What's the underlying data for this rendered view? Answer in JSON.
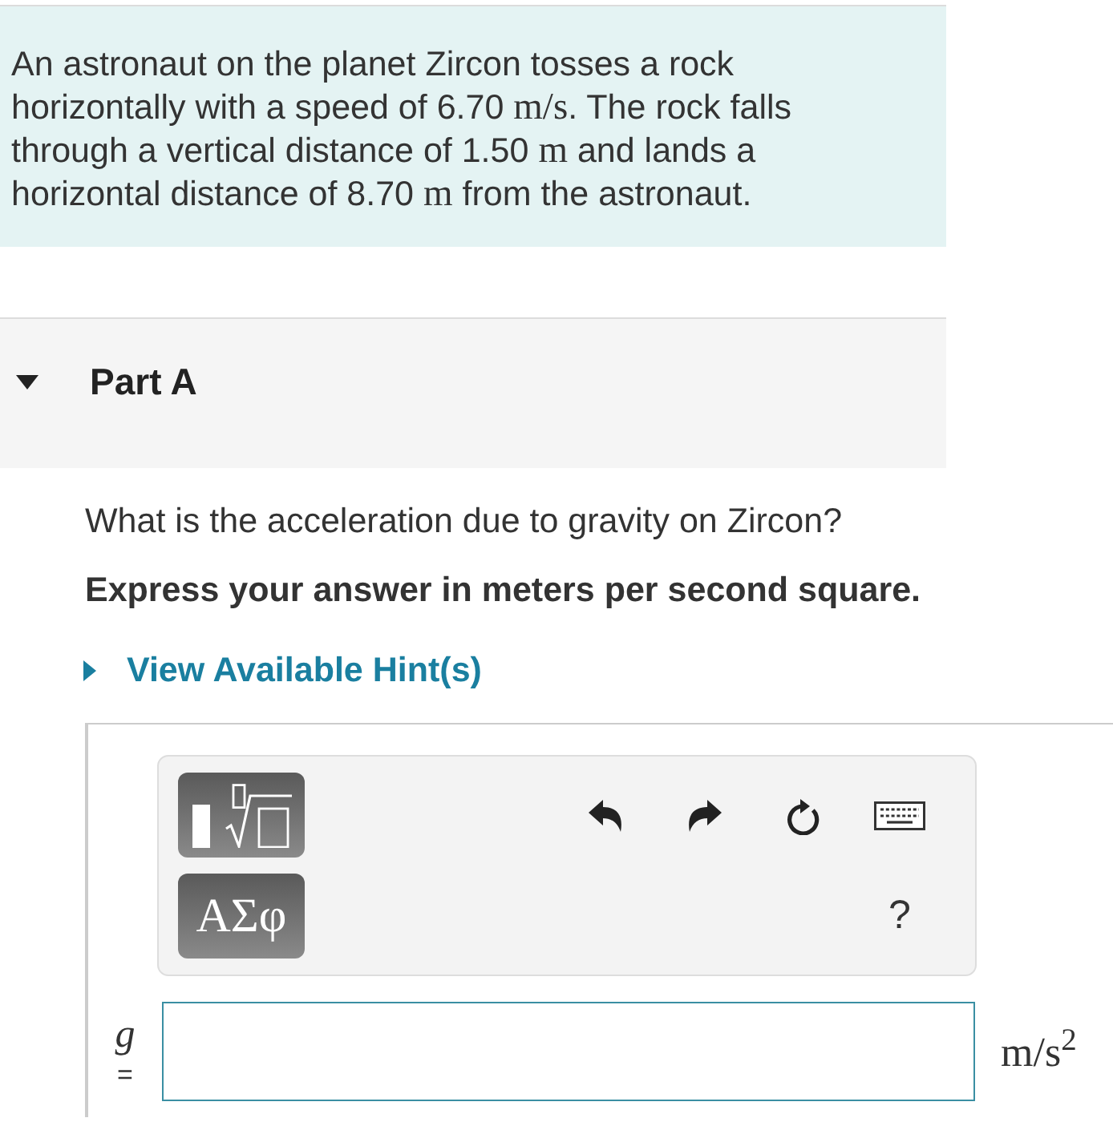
{
  "problem": {
    "segments": [
      {
        "kind": "text",
        "text": "An astronaut on the planet Zircon tosses a rock horizontally with a speed of 6.70 "
      },
      {
        "kind": "math",
        "text": "m/s"
      },
      {
        "kind": "text",
        "text": ". The rock falls through a vertical distance of 1.50 "
      },
      {
        "kind": "math",
        "text": "m"
      },
      {
        "kind": "text",
        "text": " and lands a horizontal distance of 8.70 "
      },
      {
        "kind": "math",
        "text": "m"
      },
      {
        "kind": "text",
        "text": " from the astronaut."
      }
    ]
  },
  "part": {
    "title": "Part A",
    "expanded": true,
    "question": "What is the acceleration due to gravity on Zircon?",
    "instruction": "Express your answer in meters per second square.",
    "hint": {
      "label": "View Available Hint(s)",
      "expanded": false
    }
  },
  "toolbar": {
    "buttons": [
      {
        "kind": "template"
      },
      {
        "kind": "greek",
        "label": "ΑΣφ"
      }
    ],
    "actions": [
      {
        "kind": "undo"
      },
      {
        "kind": "redo"
      },
      {
        "kind": "reset"
      },
      {
        "kind": "keyboard"
      }
    ],
    "help": {
      "label": "?"
    }
  },
  "answer": {
    "variable": "g",
    "equals": "=",
    "unit": "m/s$^{2}$"
  }
}
